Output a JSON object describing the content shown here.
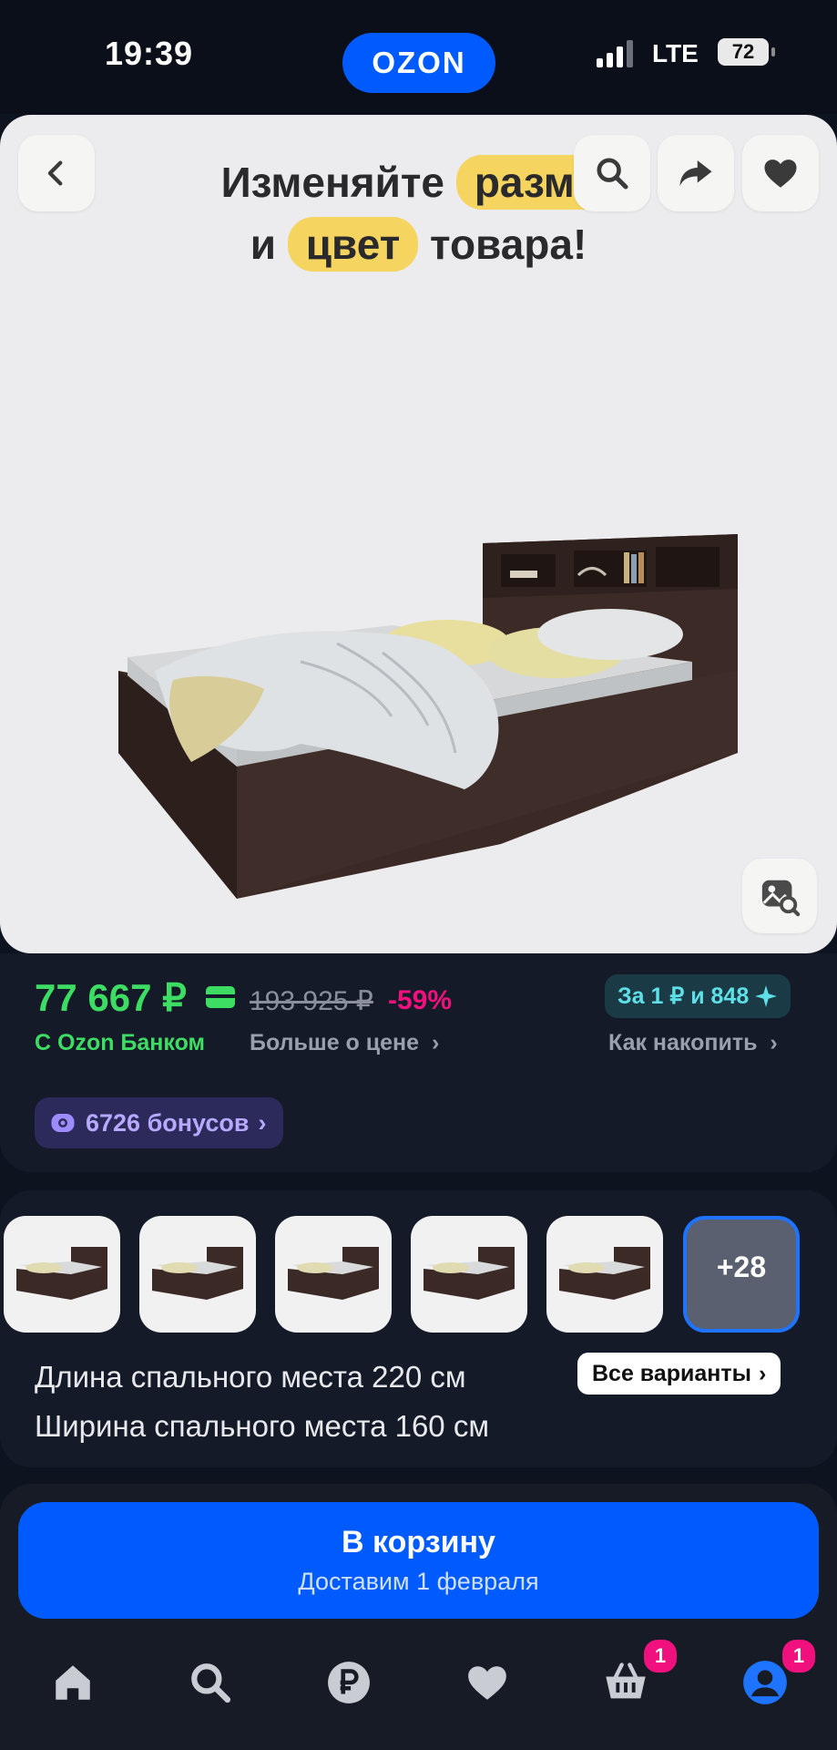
{
  "status_bar": {
    "time": "19:39",
    "network": "LTE",
    "battery": "72"
  },
  "app": {
    "logo": "OZON"
  },
  "hero": {
    "promo_line1_a": "Изменяйте",
    "promo_line1_b": "разме",
    "promo_line2_a": "и",
    "promo_line2_b": "цвет",
    "promo_line2_c": "товара!",
    "icons": [
      "back-icon",
      "search-icon",
      "share-icon",
      "favorite-icon",
      "visual-search-icon"
    ]
  },
  "price": {
    "current": "77 667 ₽",
    "old": "193 925 ₽",
    "discount": "-59%",
    "bank_label": "С Ozon Банком",
    "more_label": "Больше о цене",
    "installment": "За 1 ₽ и 848",
    "how_label": "Как накопить",
    "bonus": "6726 бонусов"
  },
  "variants": {
    "more_count": "+28",
    "spec1": "Длина спального места 220 см",
    "spec2": "Ширина спального места 160 см",
    "all_label": "Все варианты"
  },
  "cart": {
    "label": "В корзину",
    "delivery": "Доставим 1 февраля"
  },
  "nav": {
    "items": [
      "home-icon",
      "search-icon",
      "ruble-icon",
      "heart-icon",
      "cart-icon",
      "profile-icon"
    ],
    "cart_badge": "1",
    "profile_badge": "1"
  },
  "colors": {
    "brand": "#005bff",
    "price_green": "#3ddc63",
    "discount_pink": "#f1117e",
    "background": "#0e1320"
  }
}
